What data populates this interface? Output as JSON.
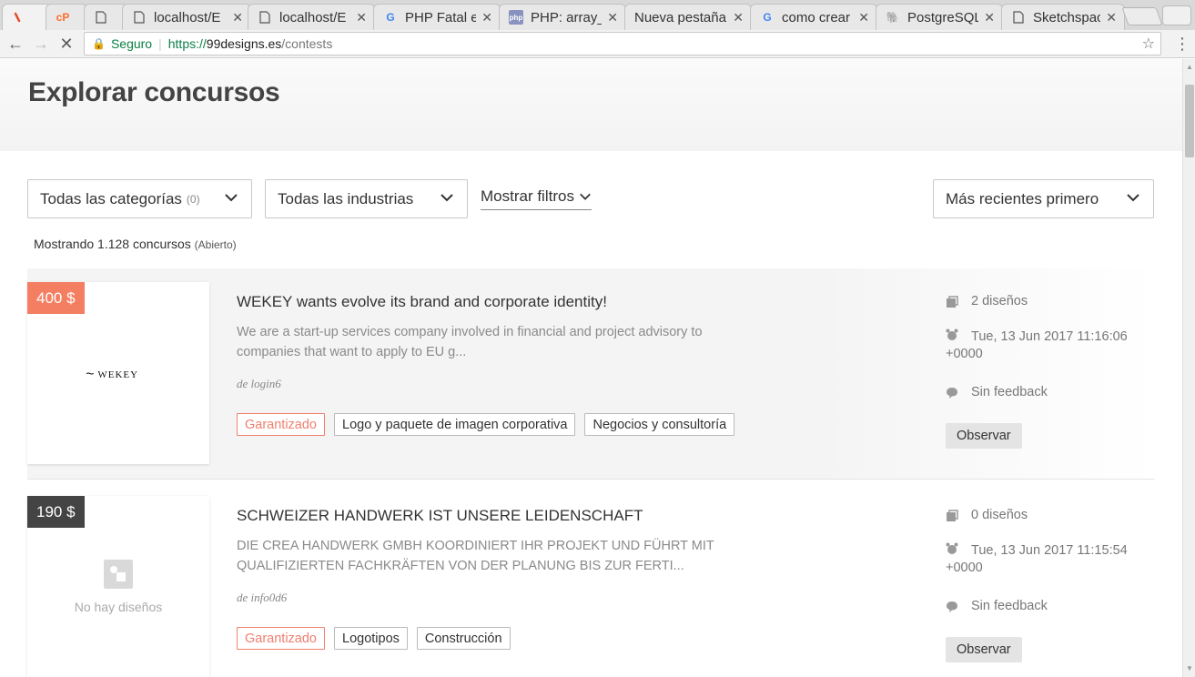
{
  "browser": {
    "tabs": [
      {
        "title": "",
        "favicon": "chrome-app-icon",
        "active": true
      },
      {
        "title": "",
        "favicon": "cpanel-icon"
      },
      {
        "title": "",
        "favicon": "page-icon"
      },
      {
        "title": "localhost/E",
        "favicon": "page-icon"
      },
      {
        "title": "localhost/E",
        "favicon": "page-icon"
      },
      {
        "title": "PHP Fatal e",
        "favicon": "google-icon"
      },
      {
        "title": "PHP: array_",
        "favicon": "php-icon"
      },
      {
        "title": "Nueva pestaña",
        "favicon": ""
      },
      {
        "title": "como crear",
        "favicon": "google-icon"
      },
      {
        "title": "PostgreSQL",
        "favicon": "postgresql-icon"
      },
      {
        "title": "Sketchspac",
        "favicon": "page-icon"
      }
    ],
    "address": {
      "secure_label": "Seguro",
      "scheme": "https://",
      "host": "99designs.es",
      "path": "/contests"
    }
  },
  "page": {
    "title": "Explorar concursos",
    "filters": {
      "category": {
        "label": "Todas las categorías",
        "count": "(0)"
      },
      "industry": {
        "label": "Todas las industrias"
      },
      "more": {
        "label": "Mostrar filtros"
      },
      "sort": {
        "label": "Más recientes primero"
      }
    },
    "results": {
      "label": "Mostrando 1.128 concursos",
      "status": "(Abierto)"
    },
    "contests": [
      {
        "price": "400 $",
        "price_color": "#f47e62",
        "logo_text": "WEKEY",
        "title": "WEKEY wants evolve its brand and corporate identity!",
        "description": "We are a start-up services company involved in financial and project advisory to companies that want to apply to EU g...",
        "author": "de login6",
        "tags": [
          "Garantizado",
          "Logo y paquete de imagen corporativa",
          "Negocios y consultoría"
        ],
        "designs": "2 diseños",
        "date_line1": "Tue, 13 Jun 2017 11:16:06",
        "date_line2": "+0000",
        "feedback": "Sin feedback",
        "watch": "Observar"
      },
      {
        "price": "190 $",
        "price_color": "#444444",
        "no_designs": "No hay diseños",
        "title": "SCHWEIZER HANDWERK IST UNSERE LEIDENSCHAFT",
        "description": "DIE CREA HANDWERK GMBH KOORDINIERT IHR PROJEKT UND FÜHRT MIT QUALIFIZIERTEN FACHKRÄFTEN VON DER PLANUNG BIS ZUR FERTI...",
        "author": "de info0d6",
        "tags": [
          "Garantizado",
          "Logotipos",
          "Construcción"
        ],
        "designs": "0 diseños",
        "date_line1": "Tue, 13 Jun 2017 11:15:54",
        "date_line2": "+0000",
        "feedback": "Sin feedback",
        "watch": "Observar"
      }
    ]
  }
}
